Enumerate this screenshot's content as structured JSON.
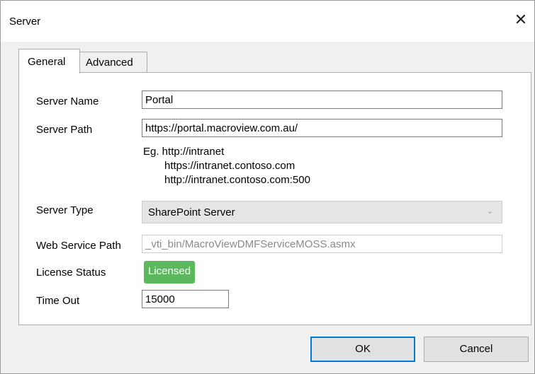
{
  "window": {
    "title": "Server",
    "close_glyph": "✕"
  },
  "tabs": [
    {
      "label": "General",
      "active": true
    },
    {
      "label": "Advanced",
      "active": false
    }
  ],
  "form": {
    "server_name": {
      "label": "Server Name",
      "value": "Portal"
    },
    "server_path": {
      "label": "Server Path",
      "value": "https://portal.macroview.com.au/"
    },
    "examples": {
      "line1": "Eg.  http://intranet",
      "line2": "https://intranet.contoso.com",
      "line3": "http://intranet.contoso.com:500"
    },
    "server_type": {
      "label": "Server Type",
      "value": "SharePoint Server"
    },
    "web_service_path": {
      "label": "Web Service Path",
      "value": "_vti_bin/MacroViewDMFServiceMOSS.asmx"
    },
    "license_status": {
      "label": "License Status",
      "value": "Licensed",
      "color": "#5cb85c"
    },
    "time_out": {
      "label": "Time Out",
      "value": "15000"
    }
  },
  "buttons": {
    "ok": "OK",
    "cancel": "Cancel"
  },
  "colors": {
    "accent": "#0078d7"
  }
}
